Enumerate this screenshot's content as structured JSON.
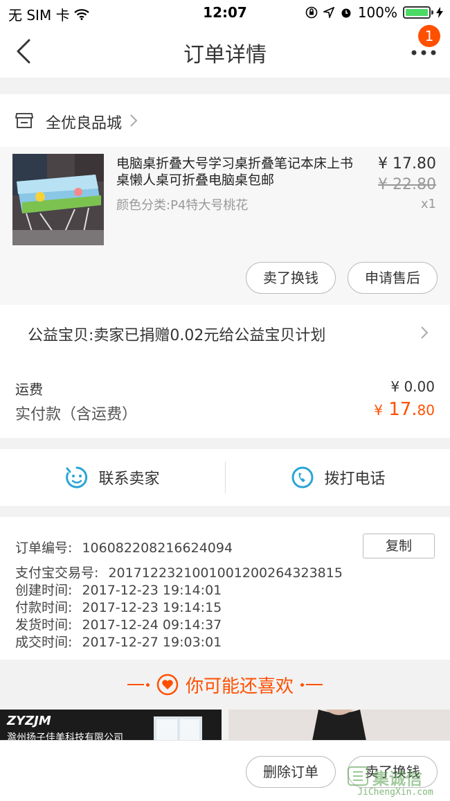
{
  "status_bar": {
    "carrier": "无 SIM 卡",
    "time": "12:07",
    "battery": "100%"
  },
  "nav": {
    "title": "订单详情",
    "badge": "1"
  },
  "shop": {
    "name": "全优良品城"
  },
  "item": {
    "title": "电脑桌折叠大号学习桌折叠笔记本床上书桌懒人桌可折叠电脑桌包邮",
    "spec": "颜色分类:P4特大号桃花",
    "price": "¥ 17.80",
    "original_price": "¥ 22.80",
    "quantity": "x1",
    "actions": [
      "卖了换钱",
      "申请售后"
    ]
  },
  "charity": {
    "text": "公益宝贝:卖家已捐赠0.02元给公益宝贝计划"
  },
  "fees": {
    "shipping_label": "运费",
    "shipping_value": "¥ 0.00",
    "paid_label": "实付款（含运费）",
    "paid_currency": "¥",
    "paid_integer": "17.",
    "paid_decimal": "80"
  },
  "contact": {
    "seller": "联系卖家",
    "call": "拨打电话"
  },
  "order_info": {
    "order_no_label": "订单编号:",
    "order_no": "106082208216624094",
    "copy": "复制",
    "alipay_label": "支付宝交易号:",
    "alipay_no": "2017122321001001200264323815",
    "created_label": "创建时间:",
    "created": "2017-12-23 19:14:01",
    "paid_label": "付款时间:",
    "paid": "2017-12-23 19:14:15",
    "shipped_label": "发货时间:",
    "shipped": "2017-12-24 09:14:37",
    "completed_label": "成交时间:",
    "completed": "2017-12-27 19:03:01"
  },
  "recommend": {
    "title": "你可能还喜欢",
    "card1_brand": "ZYZJM",
    "card1_company": "滁州扬子佳美科技有限公司"
  },
  "bottom_actions": {
    "delete": "删除订单",
    "sell": "卖了换钱"
  },
  "watermark": {
    "text": "集诚信",
    "url": "JiChengXin.com"
  },
  "colors": {
    "accent": "#ff5000",
    "contact_icon": "#2aa4d8"
  }
}
